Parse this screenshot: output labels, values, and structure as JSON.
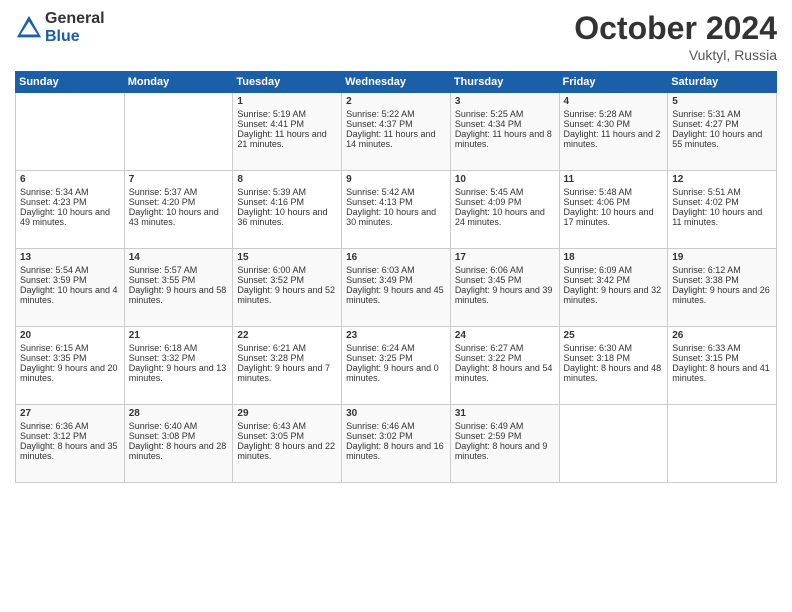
{
  "header": {
    "logo_general": "General",
    "logo_blue": "Blue",
    "month_title": "October 2024",
    "location": "Vuktyl, Russia"
  },
  "days_of_week": [
    "Sunday",
    "Monday",
    "Tuesday",
    "Wednesday",
    "Thursday",
    "Friday",
    "Saturday"
  ],
  "weeks": [
    [
      {
        "day": "",
        "info": ""
      },
      {
        "day": "",
        "info": ""
      },
      {
        "day": "1",
        "sunrise": "Sunrise: 5:19 AM",
        "sunset": "Sunset: 4:41 PM",
        "daylight": "Daylight: 11 hours and 21 minutes."
      },
      {
        "day": "2",
        "sunrise": "Sunrise: 5:22 AM",
        "sunset": "Sunset: 4:37 PM",
        "daylight": "Daylight: 11 hours and 14 minutes."
      },
      {
        "day": "3",
        "sunrise": "Sunrise: 5:25 AM",
        "sunset": "Sunset: 4:34 PM",
        "daylight": "Daylight: 11 hours and 8 minutes."
      },
      {
        "day": "4",
        "sunrise": "Sunrise: 5:28 AM",
        "sunset": "Sunset: 4:30 PM",
        "daylight": "Daylight: 11 hours and 2 minutes."
      },
      {
        "day": "5",
        "sunrise": "Sunrise: 5:31 AM",
        "sunset": "Sunset: 4:27 PM",
        "daylight": "Daylight: 10 hours and 55 minutes."
      }
    ],
    [
      {
        "day": "6",
        "sunrise": "Sunrise: 5:34 AM",
        "sunset": "Sunset: 4:23 PM",
        "daylight": "Daylight: 10 hours and 49 minutes."
      },
      {
        "day": "7",
        "sunrise": "Sunrise: 5:37 AM",
        "sunset": "Sunset: 4:20 PM",
        "daylight": "Daylight: 10 hours and 43 minutes."
      },
      {
        "day": "8",
        "sunrise": "Sunrise: 5:39 AM",
        "sunset": "Sunset: 4:16 PM",
        "daylight": "Daylight: 10 hours and 36 minutes."
      },
      {
        "day": "9",
        "sunrise": "Sunrise: 5:42 AM",
        "sunset": "Sunset: 4:13 PM",
        "daylight": "Daylight: 10 hours and 30 minutes."
      },
      {
        "day": "10",
        "sunrise": "Sunrise: 5:45 AM",
        "sunset": "Sunset: 4:09 PM",
        "daylight": "Daylight: 10 hours and 24 minutes."
      },
      {
        "day": "11",
        "sunrise": "Sunrise: 5:48 AM",
        "sunset": "Sunset: 4:06 PM",
        "daylight": "Daylight: 10 hours and 17 minutes."
      },
      {
        "day": "12",
        "sunrise": "Sunrise: 5:51 AM",
        "sunset": "Sunset: 4:02 PM",
        "daylight": "Daylight: 10 hours and 11 minutes."
      }
    ],
    [
      {
        "day": "13",
        "sunrise": "Sunrise: 5:54 AM",
        "sunset": "Sunset: 3:59 PM",
        "daylight": "Daylight: 10 hours and 4 minutes."
      },
      {
        "day": "14",
        "sunrise": "Sunrise: 5:57 AM",
        "sunset": "Sunset: 3:55 PM",
        "daylight": "Daylight: 9 hours and 58 minutes."
      },
      {
        "day": "15",
        "sunrise": "Sunrise: 6:00 AM",
        "sunset": "Sunset: 3:52 PM",
        "daylight": "Daylight: 9 hours and 52 minutes."
      },
      {
        "day": "16",
        "sunrise": "Sunrise: 6:03 AM",
        "sunset": "Sunset: 3:49 PM",
        "daylight": "Daylight: 9 hours and 45 minutes."
      },
      {
        "day": "17",
        "sunrise": "Sunrise: 6:06 AM",
        "sunset": "Sunset: 3:45 PM",
        "daylight": "Daylight: 9 hours and 39 minutes."
      },
      {
        "day": "18",
        "sunrise": "Sunrise: 6:09 AM",
        "sunset": "Sunset: 3:42 PM",
        "daylight": "Daylight: 9 hours and 32 minutes."
      },
      {
        "day": "19",
        "sunrise": "Sunrise: 6:12 AM",
        "sunset": "Sunset: 3:38 PM",
        "daylight": "Daylight: 9 hours and 26 minutes."
      }
    ],
    [
      {
        "day": "20",
        "sunrise": "Sunrise: 6:15 AM",
        "sunset": "Sunset: 3:35 PM",
        "daylight": "Daylight: 9 hours and 20 minutes."
      },
      {
        "day": "21",
        "sunrise": "Sunrise: 6:18 AM",
        "sunset": "Sunset: 3:32 PM",
        "daylight": "Daylight: 9 hours and 13 minutes."
      },
      {
        "day": "22",
        "sunrise": "Sunrise: 6:21 AM",
        "sunset": "Sunset: 3:28 PM",
        "daylight": "Daylight: 9 hours and 7 minutes."
      },
      {
        "day": "23",
        "sunrise": "Sunrise: 6:24 AM",
        "sunset": "Sunset: 3:25 PM",
        "daylight": "Daylight: 9 hours and 0 minutes."
      },
      {
        "day": "24",
        "sunrise": "Sunrise: 6:27 AM",
        "sunset": "Sunset: 3:22 PM",
        "daylight": "Daylight: 8 hours and 54 minutes."
      },
      {
        "day": "25",
        "sunrise": "Sunrise: 6:30 AM",
        "sunset": "Sunset: 3:18 PM",
        "daylight": "Daylight: 8 hours and 48 minutes."
      },
      {
        "day": "26",
        "sunrise": "Sunrise: 6:33 AM",
        "sunset": "Sunset: 3:15 PM",
        "daylight": "Daylight: 8 hours and 41 minutes."
      }
    ],
    [
      {
        "day": "27",
        "sunrise": "Sunrise: 6:36 AM",
        "sunset": "Sunset: 3:12 PM",
        "daylight": "Daylight: 8 hours and 35 minutes."
      },
      {
        "day": "28",
        "sunrise": "Sunrise: 6:40 AM",
        "sunset": "Sunset: 3:08 PM",
        "daylight": "Daylight: 8 hours and 28 minutes."
      },
      {
        "day": "29",
        "sunrise": "Sunrise: 6:43 AM",
        "sunset": "Sunset: 3:05 PM",
        "daylight": "Daylight: 8 hours and 22 minutes."
      },
      {
        "day": "30",
        "sunrise": "Sunrise: 6:46 AM",
        "sunset": "Sunset: 3:02 PM",
        "daylight": "Daylight: 8 hours and 16 minutes."
      },
      {
        "day": "31",
        "sunrise": "Sunrise: 6:49 AM",
        "sunset": "Sunset: 2:59 PM",
        "daylight": "Daylight: 8 hours and 9 minutes."
      },
      {
        "day": "",
        "info": ""
      },
      {
        "day": "",
        "info": ""
      }
    ]
  ]
}
